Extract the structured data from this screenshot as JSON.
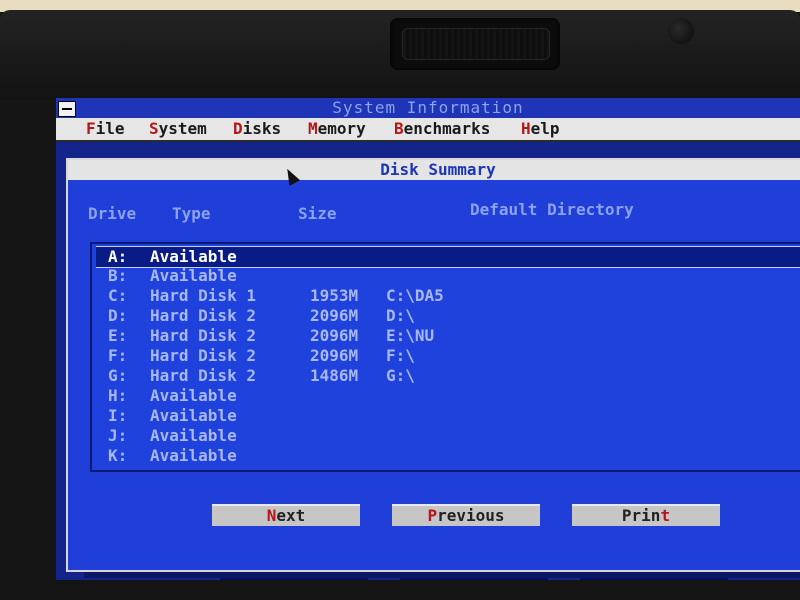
{
  "window": {
    "title": "System Information"
  },
  "menu": {
    "items": [
      {
        "label": "File",
        "hotkey": "F",
        "rest": "ile"
      },
      {
        "label": "System",
        "hotkey": "S",
        "rest": "ystem"
      },
      {
        "label": "Disks",
        "hotkey": "D",
        "rest": "isks"
      },
      {
        "label": "Memory",
        "hotkey": "M",
        "rest": "emory"
      },
      {
        "label": "Benchmarks",
        "hotkey": "B",
        "rest": "enchmarks"
      },
      {
        "label": "Help",
        "hotkey": "H",
        "rest": "elp"
      }
    ]
  },
  "dialog": {
    "title": "Disk Summary",
    "headers": {
      "drive": "Drive",
      "type": "Type",
      "size": "Size",
      "dir": "Default Directory"
    },
    "rows": [
      {
        "drive": "A:",
        "type": "Available",
        "size": "",
        "dir": ""
      },
      {
        "drive": "B:",
        "type": "Available",
        "size": "",
        "dir": ""
      },
      {
        "drive": "C:",
        "type": "Hard Disk 1",
        "size": "1953M",
        "dir": "C:\\DA5"
      },
      {
        "drive": "D:",
        "type": "Hard Disk 2",
        "size": "2096M",
        "dir": "D:\\"
      },
      {
        "drive": "E:",
        "type": "Hard Disk 2",
        "size": "2096M",
        "dir": "E:\\NU"
      },
      {
        "drive": "F:",
        "type": "Hard Disk 2",
        "size": "2096M",
        "dir": "F:\\"
      },
      {
        "drive": "G:",
        "type": "Hard Disk 2",
        "size": "1486M",
        "dir": "G:\\"
      },
      {
        "drive": "H:",
        "type": "Available",
        "size": "",
        "dir": ""
      },
      {
        "drive": "I:",
        "type": "Available",
        "size": "",
        "dir": ""
      },
      {
        "drive": "J:",
        "type": "Available",
        "size": "",
        "dir": ""
      },
      {
        "drive": "K:",
        "type": "Available",
        "size": "",
        "dir": ""
      }
    ],
    "selected_index": 0,
    "buttons": {
      "next": {
        "hotkey": "N",
        "rest": "ext"
      },
      "previous": {
        "hotkey": "P",
        "rest": "revious"
      },
      "print": {
        "pre": "Prin",
        "hotkey": "t"
      }
    }
  },
  "colors": {
    "screen_blue": "#1f3fd8",
    "title_blue": "#1d35b6",
    "menu_gray": "#e6e6e6",
    "hotkey_red": "#b5161a",
    "selected_row": "#081b86"
  },
  "icons": {
    "system_menu": "system-menu-icon",
    "mouse": "mouse-pointer-icon"
  }
}
